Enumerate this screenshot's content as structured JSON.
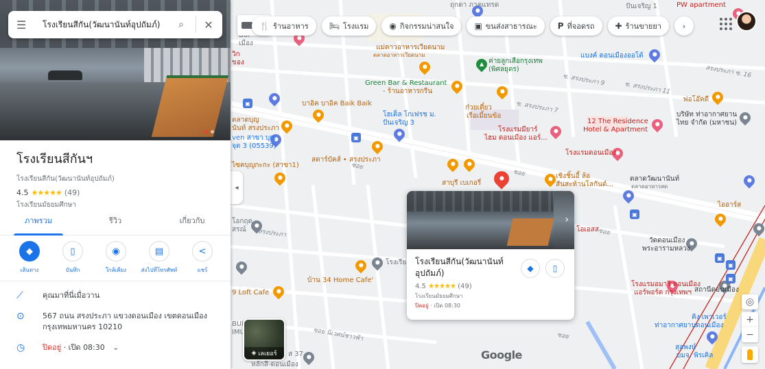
{
  "search": {
    "query": "โรงเรียนสีกัน(วัฒนานันท์อุปถัมภ์)"
  },
  "place": {
    "name": "โรงเรียนสีกันฯ",
    "full_name": "โรงเรียนสีกัน(วัฒนานันท์อุปถัมภ์)",
    "rating": "4.5",
    "stars": "★★★★★",
    "review_count": "(49)",
    "category": "โรงเรียนมัธยมศึกษา"
  },
  "tabs": [
    {
      "label": "ภาพรวม",
      "active": true
    },
    {
      "label": "รีวิว",
      "active": false
    },
    {
      "label": "เกี่ยวกับ",
      "active": false
    }
  ],
  "actions": [
    {
      "label": "เส้นทาง",
      "icon": "directions-icon"
    },
    {
      "label": "บันทึก",
      "icon": "bookmark-icon"
    },
    {
      "label": "ใกล้เคียง",
      "icon": "nearby-icon"
    },
    {
      "label": "ส่งไปที่โทรศัพท์",
      "icon": "phone-send-icon"
    },
    {
      "label": "แชร์",
      "icon": "share-icon"
    }
  ],
  "details": {
    "popular": "คุณมาที่นี่เมื่อวาน",
    "address_line1": "567 ถนน สรงประภา แขวงดอนเมือง เขตดอนเมือง",
    "address_line2": "กรุงเทพมหานคร 10210",
    "hours_closed": "ปิดอยู่",
    "hours_open": "· เปิด 08:30"
  },
  "chips": [
    {
      "label": "ร้านอาหาร",
      "icon": "restaurant-icon"
    },
    {
      "label": "โรงแรม",
      "icon": "hotel-icon"
    },
    {
      "label": "กิจกรรมน่าสนใจ",
      "icon": "camera-icon"
    },
    {
      "label": "ขนส่งสาธารณะ",
      "icon": "transit-icon"
    },
    {
      "label": "ที่จอดรถ",
      "icon": "parking-icon"
    },
    {
      "label": "ร้านขายยา",
      "icon": "pharmacy-icon"
    }
  ],
  "popup": {
    "title_line1": "โรงเรียนสีกัน(วัฒนานันท์",
    "title_line2": "อุปถัมภ์)",
    "rating": "4.5",
    "stars": "★★★★★",
    "count": "(49)",
    "category": "โรงเรียนมัธยมศึกษา",
    "closed": "ปิดอยู่",
    "open": " · เปิด 08:30"
  },
  "map_labels": {
    "tokyo_top": "ถุกตา ภาคแทรด",
    "vegetable": "แม่ดาวอาหารเวียดนาม",
    "vegetable_sub": "ตลาดอาหารเวียดนาม",
    "scout": "ค่ายลูกเสือกรุงเทพ",
    "scout_sub": "(พิศลยุตร)",
    "bank": "แบงค์ ดอนเมืองออโต้",
    "green_bar": "Green Bar & Restaurant",
    "green_bar_sub": "- ร้านอาหารกรีน",
    "baik": "บาอิค บาอิค Baik Baik",
    "soi9": "ซ. สรงประภา 9",
    "soi11": "ซ. สรงประภา 11",
    "soi16": "สรงประภา ซ. 16",
    "soi7": "ซ. สรงประภา 7",
    "hotel_soi": "โฮเต็ล โกเฟรช ม.",
    "hotel_soi2": "ปันเจริญ 3",
    "noodle": "ก๋วยเตี๋ยว",
    "noodle2": "เรือเมี้ยนข้อ",
    "residence": "12 The Residence",
    "residence2": "Hotel & Apartment",
    "company": "บริษัท ท่าอากาศยาน",
    "company2": "ไทย จำกัด (มหาชน)",
    "pho": "พ่อโอ๊คดี",
    "hotel_don": "โรงแรมมียาร์",
    "hotel_don2": "ไฮม ดอนเมือง แอร์...",
    "mkt": "ตลาดบุญ",
    "mkt2": "นันท์ สรงประภา",
    "seven": "ven สาขา บุญ",
    "seven2": "จุด 3 (05539)",
    "starbucks": "สตาร์บัคส์ • สรงประภา",
    "roadside": "ไซคบุญกะกะ (สาขา1)",
    "hotel_dm": "โรงแรมดอนเมือง",
    "sarabur": "สาบุรี เบเกอรี่",
    "chicken": "เชิงชิ้นอี้ ล้อ",
    "chicken2": "สันสะท้านโลกันต์...",
    "market_wn": "ตลาดวัฒนานันท์",
    "market_wn2": "ตลาดอาหารสด",
    "wat": "วัดดอนเมือง",
    "wat2": "พระอารามหลวง",
    "hotel_as": "โรงแรมอมารี ดอนเมือง",
    "hotel_as2": "แอร์พอร์ต กรุงเทพฯ",
    "station": "สถานีดอนเมือง",
    "home_cafe": "บ้าน 34 Home Cafe'",
    "loft": "9 Loft Cafe",
    "kingpower": "คิง เพาเวอร์",
    "kingpower2": "ท่าอากาศยานดอนเมือง",
    "lawpong": "สุลพงษ์",
    "lawpong2": "บมจ. พิรเคิล",
    "road_songprapa": "สรงประภา",
    "road_nivet": "ซอย นิเวศน์ชาวฟ้า",
    "road_bl": "ซอย",
    "kasem": "หลักสี่-ดอนเมือง",
    "kasem_num": "ส 37",
    "okathu": "โอกฤต",
    "okathu2": "สรณ์",
    "pw": "PW apartment",
    "panjaroen": "ปันเจริญ 1",
    "orders": "โอเอสส",
    "bal": "Bal",
    "bal2": "เมือง",
    "vic": "วิก",
    "vic2": "ของ",
    "bui": "BUI",
    "bui2": "IMU",
    "oas": "ไออาร์ส",
    "gs": "โรงเรีย",
    "gs2": "ทหร"
  },
  "map_ui": {
    "layers_label": "เลเยอร์",
    "google": "Google"
  }
}
